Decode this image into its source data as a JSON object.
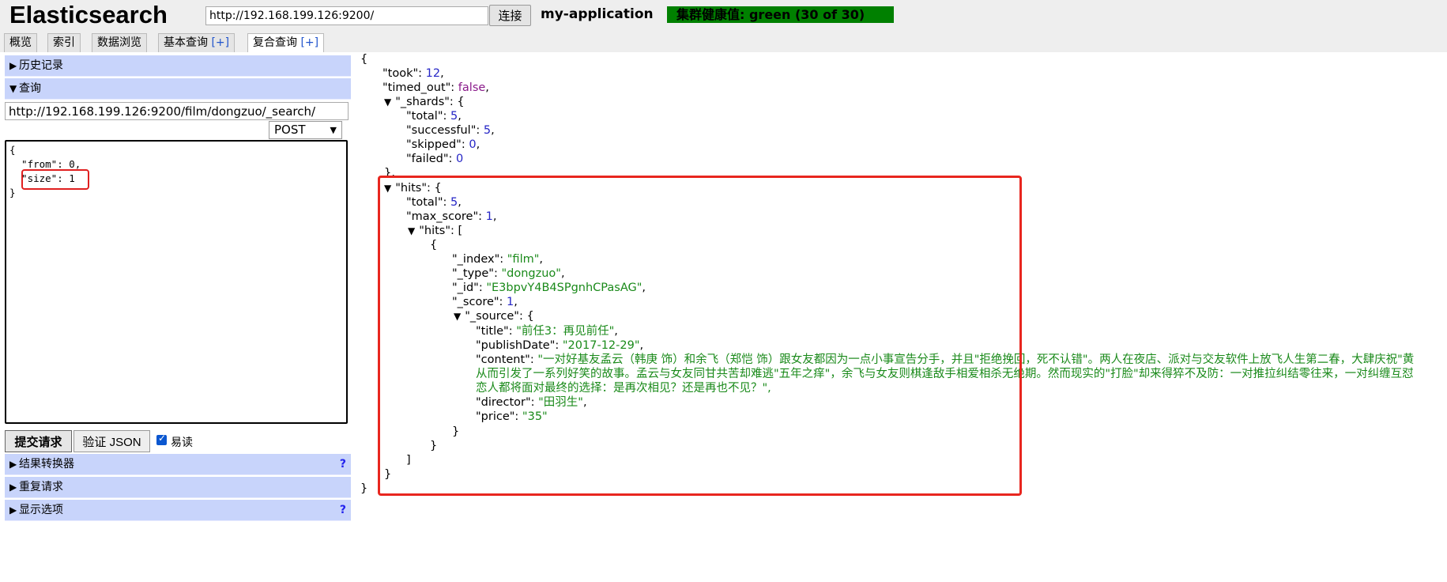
{
  "header": {
    "app_title": "Elasticsearch",
    "cluster_url": "http://192.168.199.126:9200/",
    "connect_label": "连接",
    "cluster_name": "my-application",
    "health_text": "集群健康值: green (30 of 30)",
    "health_color": "#008000"
  },
  "tabs": [
    {
      "label": "概览"
    },
    {
      "label": "索引"
    },
    {
      "label": "数据浏览"
    },
    {
      "label": "基本查询",
      "plus": "[+]"
    },
    {
      "label": "复合查询",
      "plus": "[+]",
      "active": true
    }
  ],
  "left": {
    "history_label": "历史记录",
    "query_label": "查询",
    "query_url": "http://192.168.199.126:9200/film/dongzuo/_search/",
    "method": "POST",
    "query_body": "{\n  \"from\": 0,\n  \"size\": 1\n}",
    "submit_label": "提交请求",
    "validate_label": "验证 JSON",
    "readable_label": "易读",
    "readable_checked": true,
    "result_transformer_label": "结果转换器",
    "repeat_request_label": "重复请求",
    "display_options_label": "显示选项",
    "help_mark": "?"
  },
  "response": {
    "took": 12,
    "timed_out": "false",
    "shards": {
      "total": 5,
      "successful": 5,
      "skipped": 0,
      "failed": 0
    },
    "hits_total": 5,
    "max_score": 1,
    "hit": {
      "index": "\"film\"",
      "type": "\"dongzuo\"",
      "id": "\"E3bpvY4B4SPgnhCPasAG\"",
      "score": 1,
      "source": {
        "title": "\"前任3：再见前任\"",
        "publishDate": "\"2017-12-29\"",
        "content_line1": "\"一对好基友孟云（韩庚 饰）和余飞（郑恺 饰）跟女友都因为一点小事宣告分手，并且\"拒绝挽回，死不认错\"。两人在夜店、派对与交友软件上放飞人生第二春，大肆庆祝\"黄",
        "content_line2": "从而引发了一系列好笑的故事。孟云与女友同甘共苦却难逃\"五年之痒\"，余飞与女友则棋逢敌手相爱相杀无绝期。然而现实的\"打脸\"却来得猝不及防：一对推拉纠结零往来，一对纠缠互怼",
        "content_line3": "恋人都将面对最终的选择：是再次相见？还是再也不见？\",",
        "director": "\"田羽生\"",
        "price": "\"35\""
      }
    }
  }
}
